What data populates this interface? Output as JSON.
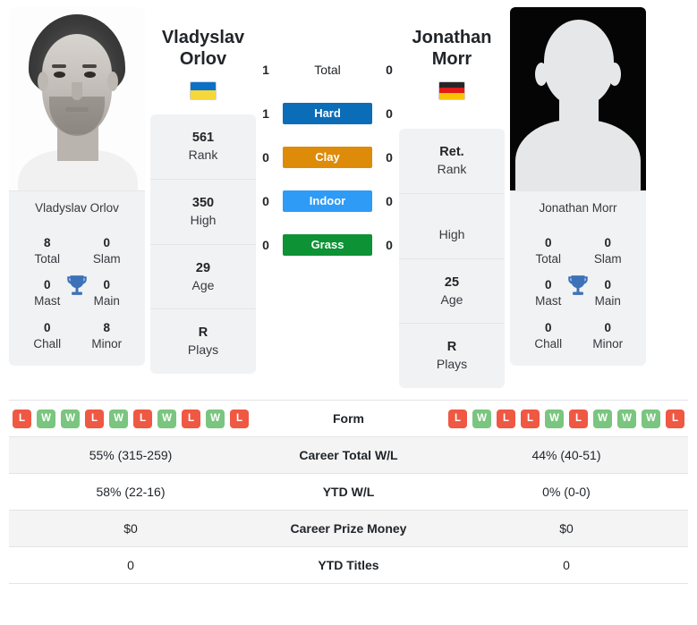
{
  "players": {
    "left": {
      "first_name": "Vladyslav",
      "last_name": "Orlov",
      "full_name": "Vladyslav Orlov",
      "flag": "ukraine-flag",
      "photo": "player-photo",
      "stats": [
        {
          "value": "561",
          "label": "Rank"
        },
        {
          "value": "350",
          "label": "High"
        },
        {
          "value": "29",
          "label": "Age"
        },
        {
          "value": "R",
          "label": "Plays"
        }
      ],
      "titles": [
        {
          "value": "8",
          "label": "Total"
        },
        {
          "value": "0",
          "label": "Slam"
        },
        {
          "value": "0",
          "label": "Mast"
        },
        {
          "value": "0",
          "label": "Main"
        },
        {
          "value": "0",
          "label": "Chall"
        },
        {
          "value": "8",
          "label": "Minor"
        }
      ],
      "form": [
        "L",
        "W",
        "W",
        "L",
        "W",
        "L",
        "W",
        "L",
        "W",
        "L"
      ],
      "career_total_wl": "55% (315-259)",
      "ytd_wl": "58% (22-16)",
      "career_prize_money": "$0",
      "ytd_titles": "0"
    },
    "right": {
      "first_name": "Jonathan",
      "last_name": "Morr",
      "full_name": "Jonathan Morr",
      "flag": "germany-flag",
      "photo": "player-photo-placeholder",
      "stats": [
        {
          "value": "Ret.",
          "label": "Rank"
        },
        {
          "value": "",
          "label": "High"
        },
        {
          "value": "25",
          "label": "Age"
        },
        {
          "value": "R",
          "label": "Plays"
        }
      ],
      "titles": [
        {
          "value": "0",
          "label": "Total"
        },
        {
          "value": "0",
          "label": "Slam"
        },
        {
          "value": "0",
          "label": "Mast"
        },
        {
          "value": "0",
          "label": "Main"
        },
        {
          "value": "0",
          "label": "Chall"
        },
        {
          "value": "0",
          "label": "Minor"
        }
      ],
      "form": [
        "L",
        "W",
        "L",
        "L",
        "W",
        "L",
        "W",
        "W",
        "W",
        "L"
      ],
      "career_total_wl": "44% (40-51)",
      "ytd_wl": "0% (0-0)",
      "career_prize_money": "$0",
      "ytd_titles": "0"
    }
  },
  "surfaces": [
    {
      "label": "Total",
      "left": "1",
      "right": "0",
      "color": "none"
    },
    {
      "label": "Hard",
      "left": "1",
      "right": "0",
      "color": "#0b6cb8"
    },
    {
      "label": "Clay",
      "left": "0",
      "right": "0",
      "color": "#dd8b08"
    },
    {
      "label": "Indoor",
      "left": "0",
      "right": "0",
      "color": "#2e9bf7"
    },
    {
      "label": "Grass",
      "left": "0",
      "right": "0",
      "color": "#0d9235"
    }
  ],
  "table_rows": [
    {
      "label": "Form"
    },
    {
      "label": "Career Total W/L"
    },
    {
      "label": "YTD W/L"
    },
    {
      "label": "Career Prize Money"
    },
    {
      "label": "YTD Titles"
    }
  ],
  "colors": {
    "win": "#7ac57f",
    "loss": "#ef5843",
    "panel": "#f1f2f3",
    "row_shade": "#f4f4f5",
    "trophy": "#3d72b8"
  }
}
